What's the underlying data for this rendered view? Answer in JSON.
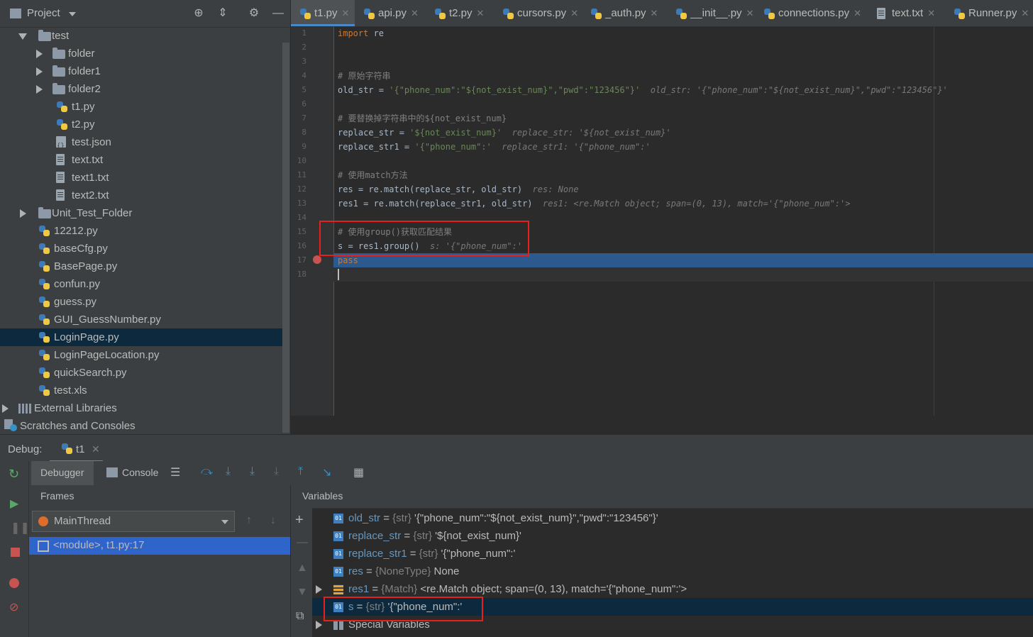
{
  "project": {
    "title": "Project",
    "tree": [
      {
        "label": "test",
        "type": "folder",
        "indent": 1,
        "expanded": true
      },
      {
        "label": "folder",
        "type": "folder",
        "indent": 2,
        "expanded": false
      },
      {
        "label": "folder1",
        "type": "folder",
        "indent": 2,
        "expanded": false
      },
      {
        "label": "folder2",
        "type": "folder",
        "indent": 2,
        "expanded": false
      },
      {
        "label": "t1.py",
        "type": "py",
        "indent": 3
      },
      {
        "label": "t2.py",
        "type": "py",
        "indent": 3
      },
      {
        "label": "test.json",
        "type": "json",
        "indent": 3
      },
      {
        "label": "text.txt",
        "type": "txt",
        "indent": 3
      },
      {
        "label": "text1.txt",
        "type": "txt",
        "indent": 3
      },
      {
        "label": "text2.txt",
        "type": "txt",
        "indent": 3
      },
      {
        "label": "Unit_Test_Folder",
        "type": "folder",
        "indent": 1,
        "expanded": false
      },
      {
        "label": "12212.py",
        "type": "py",
        "indent": 2
      },
      {
        "label": "baseCfg.py",
        "type": "py",
        "indent": 2
      },
      {
        "label": "BasePage.py",
        "type": "py",
        "indent": 2
      },
      {
        "label": "confun.py",
        "type": "py",
        "indent": 2
      },
      {
        "label": "guess.py",
        "type": "py",
        "indent": 2
      },
      {
        "label": "GUI_GuessNumber.py",
        "type": "py",
        "indent": 2
      },
      {
        "label": "LoginPage.py",
        "type": "py",
        "indent": 2,
        "selected": true
      },
      {
        "label": "LoginPageLocation.py",
        "type": "py",
        "indent": 2
      },
      {
        "label": "quickSearch.py",
        "type": "py",
        "indent": 2
      },
      {
        "label": "test.xls",
        "type": "xls",
        "indent": 2
      },
      {
        "label": "External Libraries",
        "type": "lib",
        "indent": 0,
        "expanded": false
      },
      {
        "label": "Scratches and Consoles",
        "type": "scratch",
        "indent": 0
      }
    ]
  },
  "tabs": [
    {
      "label": "t1.py",
      "type": "py",
      "active": true
    },
    {
      "label": "api.py",
      "type": "py"
    },
    {
      "label": "t2.py",
      "type": "py"
    },
    {
      "label": "cursors.py",
      "type": "py"
    },
    {
      "label": "_auth.py",
      "type": "py"
    },
    {
      "label": "__init__.py",
      "type": "py"
    },
    {
      "label": "connections.py",
      "type": "py"
    },
    {
      "label": "text.txt",
      "type": "txt"
    },
    {
      "label": "Runner.py",
      "type": "py"
    }
  ],
  "editor": {
    "lines": [
      {
        "n": "1",
        "code": "<span class='kw'>import</span> re"
      },
      {
        "n": "2",
        "code": ""
      },
      {
        "n": "3",
        "code": ""
      },
      {
        "n": "4",
        "code": "<span class='cm'># 原始字符串</span>"
      },
      {
        "n": "5",
        "code": "old_str = <span class='str'>'{\"phone_num\":\"${not_exist_num}\",\"pwd\":\"123456\"}'</span>  <span class='hint'>old_str: '{\"phone_num\":\"${not_exist_num}\",\"pwd\":\"123456\"}'</span>"
      },
      {
        "n": "6",
        "code": ""
      },
      {
        "n": "7",
        "code": "<span class='cm'># 要替换掉字符串中的${not_exist_num}</span>"
      },
      {
        "n": "8",
        "code": "replace_str = <span class='str'>'${not_exist_num}'</span>  <span class='hint'>replace_str: '${not_exist_num}'</span>"
      },
      {
        "n": "9",
        "code": "replace_str1 = <span class='str'>'{\"phone_num\":'</span>  <span class='hint'>replace_str1: '{\"phone_num\":'</span>"
      },
      {
        "n": "10",
        "code": ""
      },
      {
        "n": "11",
        "code": "<span class='cm'># 使用match方法</span>"
      },
      {
        "n": "12",
        "code": "res = re.match(replace_str, old_str)  <span class='hint'>res: None</span>"
      },
      {
        "n": "13",
        "code": "res1 = re.match(replace_str1, old_str)  <span class='hint'>res1: &lt;re.Match object; span=(0, 13), match='{\"phone_num\":'&gt;</span>"
      },
      {
        "n": "14",
        "code": ""
      },
      {
        "n": "15",
        "code": "<span class='cm'># 使用group()获取匹配结果</span>"
      },
      {
        "n": "16",
        "code": "s = res1.group()  <span class='hint'>s: '{\"phone_num\":'</span>"
      },
      {
        "n": "17",
        "code": "<span class='kw'>pass</span>"
      },
      {
        "n": "18",
        "code": ""
      }
    ]
  },
  "debug": {
    "label": "Debug:",
    "session": "t1",
    "tab_debugger": "Debugger",
    "tab_console": "Console",
    "frames_title": "Frames",
    "thread": "MainThread",
    "frame": "<module>, t1.py:17",
    "variables_title": "Variables",
    "variables": [
      {
        "name": "old_str",
        "type": "{str}",
        "value": "'{\"phone_num\":\"${not_exist_num}\",\"pwd\":\"123456\"}'",
        "icon": "01"
      },
      {
        "name": "replace_str",
        "type": "{str}",
        "value": "'${not_exist_num}'",
        "icon": "01"
      },
      {
        "name": "replace_str1",
        "type": "{str}",
        "value": "'{\"phone_num\":'",
        "icon": "01"
      },
      {
        "name": "res",
        "type": "{NoneType}",
        "value": "None",
        "icon": "01"
      },
      {
        "name": "res1",
        "type": "{Match}",
        "value": "<re.Match object; span=(0, 13), match='{\"phone_num\":'>",
        "icon": "obj",
        "expandable": true
      },
      {
        "name": "s",
        "type": "{str}",
        "value": "'{\"phone_num\":'",
        "icon": "01",
        "selected": true
      },
      {
        "name": "Special Variables",
        "type": "",
        "value": "",
        "icon": "grid",
        "expandable": true
      }
    ]
  }
}
